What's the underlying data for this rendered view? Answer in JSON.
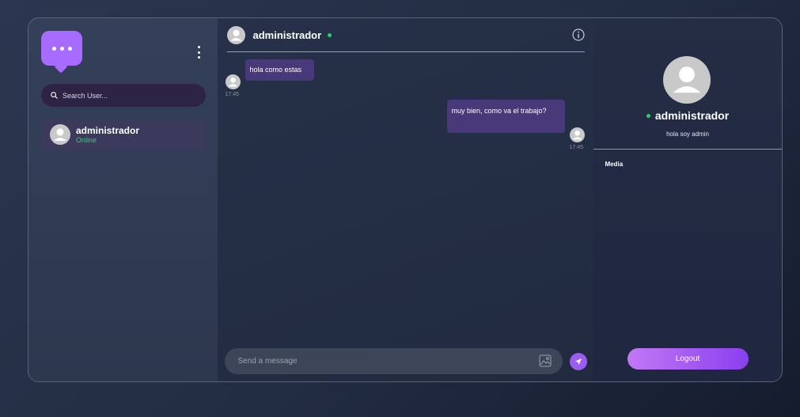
{
  "sidebar": {
    "search": {
      "placeholder": "Search User..."
    },
    "users": [
      {
        "name": "administrador",
        "status": "Online"
      }
    ]
  },
  "chat": {
    "header": {
      "name": "administrador"
    },
    "messages": [
      {
        "side": "received",
        "text": "hola como estas",
        "time": "17:45"
      },
      {
        "side": "sent",
        "text": "muy bien, como va el trabajo?",
        "time": "17:45"
      }
    ],
    "composer": {
      "placeholder": "Send a message"
    }
  },
  "details": {
    "name": "administrador",
    "bio": "hola soy admin",
    "media_label": "Media",
    "logout_label": "Logout"
  },
  "colors": {
    "accent": "#a76cff",
    "bubble": "#47397a",
    "online": "#23d165"
  },
  "icons": [
    "chat-bubble-logo-icon",
    "kebab-menu-icon",
    "search-icon",
    "user-avatar-icon",
    "info-icon",
    "image-upload-icon",
    "send-icon"
  ]
}
